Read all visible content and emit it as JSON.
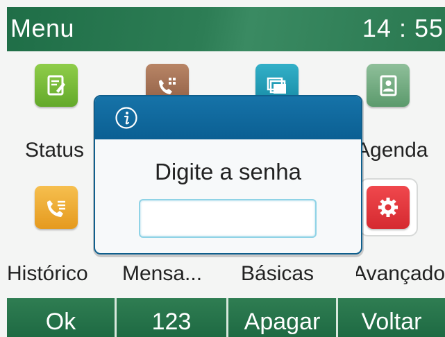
{
  "header": {
    "title": "Menu",
    "time": "14 : 55"
  },
  "menu": {
    "items": [
      {
        "label": "Status",
        "icon": "status-icon",
        "color": "#7cbf3b"
      },
      {
        "label": "",
        "icon": "call-features-icon",
        "color": "#a0735a"
      },
      {
        "label": "",
        "icon": "directory-icon",
        "color": "#1e9bb8"
      },
      {
        "label": "Agenda",
        "icon": "agenda-icon",
        "color": "#74ab82"
      },
      {
        "label": "Histórico",
        "icon": "call-history-icon",
        "color": "#f0b03c"
      },
      {
        "label": "Mensa...",
        "icon": "",
        "color": ""
      },
      {
        "label": "Básicas",
        "icon": "",
        "color": ""
      },
      {
        "label": "Avançado",
        "icon": "gear-icon",
        "color": "#e63a3f"
      }
    ]
  },
  "dialog": {
    "icon": "info-icon",
    "title": "Digite a senha",
    "password_value": ""
  },
  "softkeys": {
    "ok": "Ok",
    "num": "123",
    "delete": "Apagar",
    "back": "Voltar"
  },
  "colors": {
    "title_bar": "#2d7d55",
    "softkey": "#267548",
    "dialog_header": "#0e6699"
  }
}
